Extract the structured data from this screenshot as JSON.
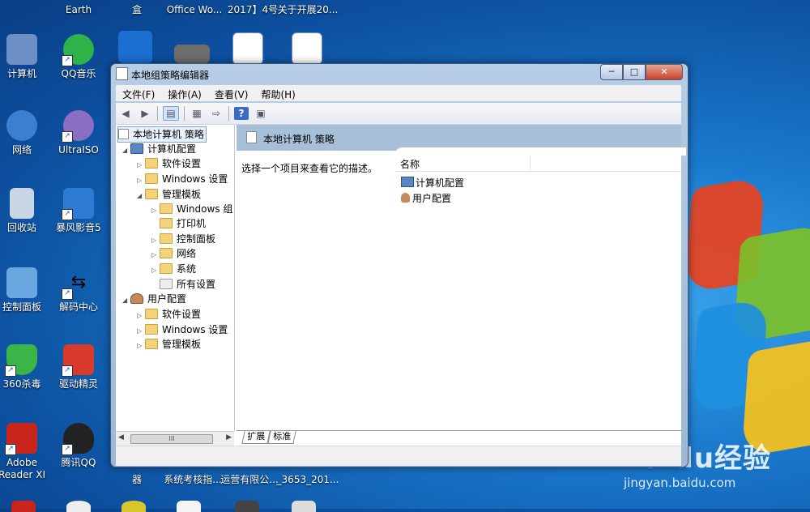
{
  "desktop": {
    "top_labels": [
      "Earth",
      "盒",
      "Office Wo...",
      "2017】4号",
      "关于开展20..."
    ],
    "icons": [
      {
        "label": "计算机",
        "icon": "computer-icon",
        "color": "#6c8fc5"
      },
      {
        "label": "QQ音乐",
        "icon": "qq-music-icon",
        "color": "#2fb24a"
      },
      {
        "label": "网络",
        "icon": "network-icon",
        "color": "#3a7fd0"
      },
      {
        "label": "UltraISO",
        "icon": "ultraiso-icon",
        "color": "#8a6fc4"
      },
      {
        "label": "回收站",
        "icon": "recycle-bin-icon",
        "color": "#c9d6e6"
      },
      {
        "label": "暴风影音5",
        "icon": "baofeng-icon",
        "color": "#2d7bd3"
      },
      {
        "label": "控制面板",
        "icon": "control-panel-icon",
        "color": "#6aa7e0"
      },
      {
        "label": "解码中心",
        "icon": "decoder-icon",
        "color": "#ffffff"
      },
      {
        "label": "360杀毒",
        "icon": "360-antivirus-icon",
        "color": "#3cb548"
      },
      {
        "label": "驱动精灵",
        "icon": "driver-genius-icon",
        "color": "#d93a2b"
      },
      {
        "label": "Adobe\nReader XI",
        "icon": "adobe-reader-icon",
        "color": "#c8261c"
      },
      {
        "label": "腾讯QQ",
        "icon": "qq-icon",
        "color": "#222222"
      }
    ],
    "bottom_labels": [
      "器",
      "系统考核指...",
      "运营有限公...",
      "_3653_201..."
    ],
    "watermark_main": "Baidu经验",
    "watermark_sub": "jingyan.baidu.com"
  },
  "window": {
    "title": "本地组策略编辑器",
    "buttons": {
      "minimize": "─",
      "maximize": "□",
      "close": "✕"
    },
    "menu": [
      "文件(F)",
      "操作(A)",
      "查看(V)",
      "帮助(H)"
    ],
    "toolbar": [
      "back-icon",
      "forward-icon",
      "show-hide-tree-icon",
      "properties-icon",
      "export-list-icon",
      "help-icon",
      "view-icon"
    ],
    "tree": {
      "root": "本地计算机 策略",
      "computer_config": "计算机配置",
      "cc_software": "软件设置",
      "cc_windows": "Windows 设置",
      "cc_admin": "管理模板",
      "admin_windows": "Windows 组",
      "admin_printer": "打印机",
      "admin_control": "控制面板",
      "admin_network": "网络",
      "admin_system": "系统",
      "admin_all": "所有设置",
      "user_config": "用户配置",
      "uc_software": "软件设置",
      "uc_windows": "Windows 设置",
      "uc_admin": "管理模板",
      "scroll_thumb": "III"
    },
    "right": {
      "header": "本地计算机 策略",
      "description": "选择一个项目来查看它的描述。",
      "column_name": "名称",
      "items": [
        "计算机配置",
        "用户配置"
      ]
    },
    "tabs": [
      "扩展",
      "标准"
    ]
  }
}
